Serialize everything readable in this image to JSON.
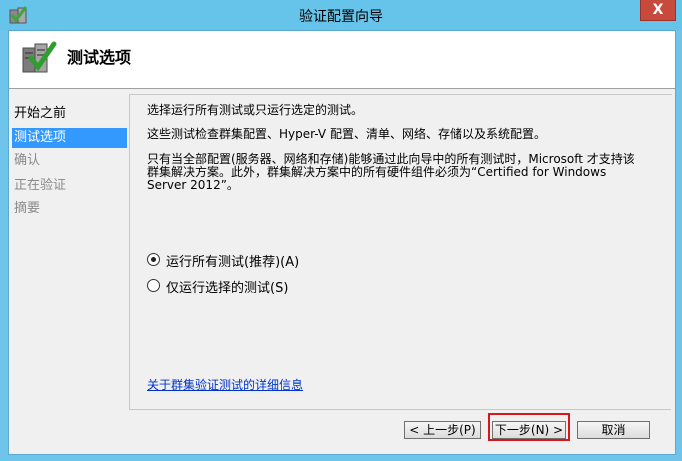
{
  "window": {
    "title": "验证配置向导",
    "close_symbol": "X"
  },
  "header": {
    "title": "测试选项",
    "icon": "checklist-icon"
  },
  "nav": {
    "items": [
      {
        "label": "开始之前",
        "state": "normal"
      },
      {
        "label": "测试选项",
        "state": "selected"
      },
      {
        "label": "确认",
        "state": "disabled"
      },
      {
        "label": "正在验证",
        "state": "disabled"
      },
      {
        "label": "摘要",
        "state": "disabled"
      }
    ]
  },
  "main": {
    "intro": "选择运行所有测试或只运行选定的测试。",
    "desc1": "这些测试检查群集配置、Hyper-V 配置、清单、网络、存储以及系统配置。",
    "desc2_line1": "只有当全部配置(服务器、网络和存储)能够通过此向导中的所有测试时，Microsoft 才支持该",
    "desc2_line2": "群集解决方案。此外，群集解决方案中的所有硬件组件必须为“Certified for Windows",
    "desc2_line3": "Server 2012”。",
    "options": [
      {
        "label": "运行所有测试(推荐)(A)",
        "checked": true
      },
      {
        "label": "仅运行选择的测试(S)",
        "checked": false
      }
    ],
    "link": "关于群集验证测试的详细信息"
  },
  "footer": {
    "prev_label": "< 上一步(P)",
    "next_label": "下一步(N) >",
    "cancel_label": "取消"
  },
  "colors": {
    "title_bar": "#66c3ea",
    "selection": "#3399ff",
    "close_button": "#c74a3d",
    "focus_highlight": "#d8161b"
  }
}
